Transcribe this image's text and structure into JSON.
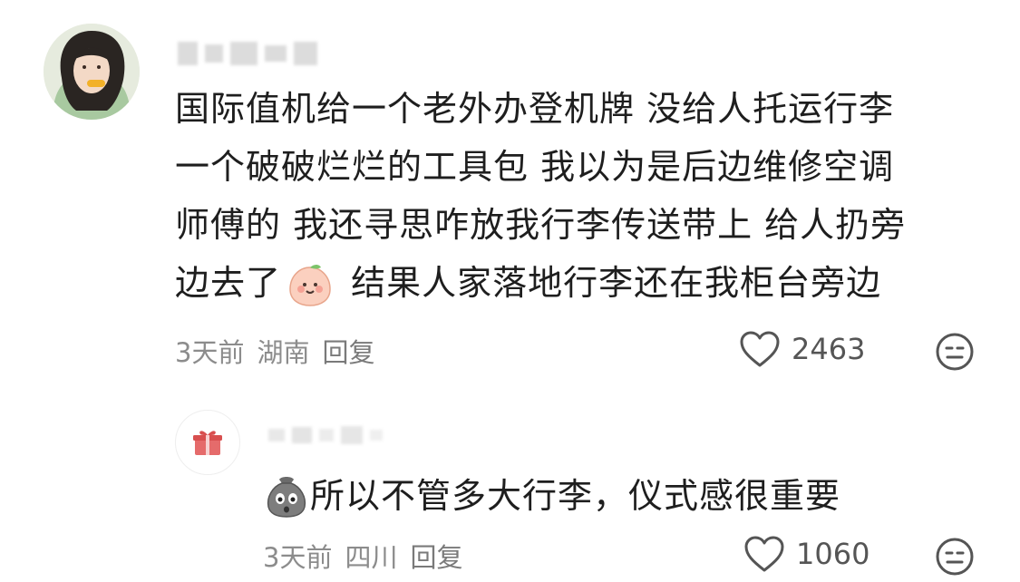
{
  "comment": {
    "lines": [
      "国际值机给一个老外办登机牌 没给人托运行李",
      "一个破破烂烂的工具包 我以为是后边维修空调",
      "师傅的 我还寻思咋放我行李传送带上 给人扔旁",
      "边去了",
      " 结果人家落地行李还在我柜台旁边"
    ],
    "emoji": "smiling-peach-emoji",
    "time": "3天前",
    "location": "湖南",
    "reply_label": "回复",
    "like_count": "2463",
    "like_icon": "heart-outline-icon",
    "dislike_icon": "meh-face-icon"
  },
  "reply": {
    "avatar_icon": "gift-icon",
    "emoji": "worried-bag-emoji",
    "text": "所以不管多大行李，仪式感很重要",
    "time": "3天前",
    "location": "四川",
    "reply_label": "回复",
    "like_count": "1060"
  }
}
